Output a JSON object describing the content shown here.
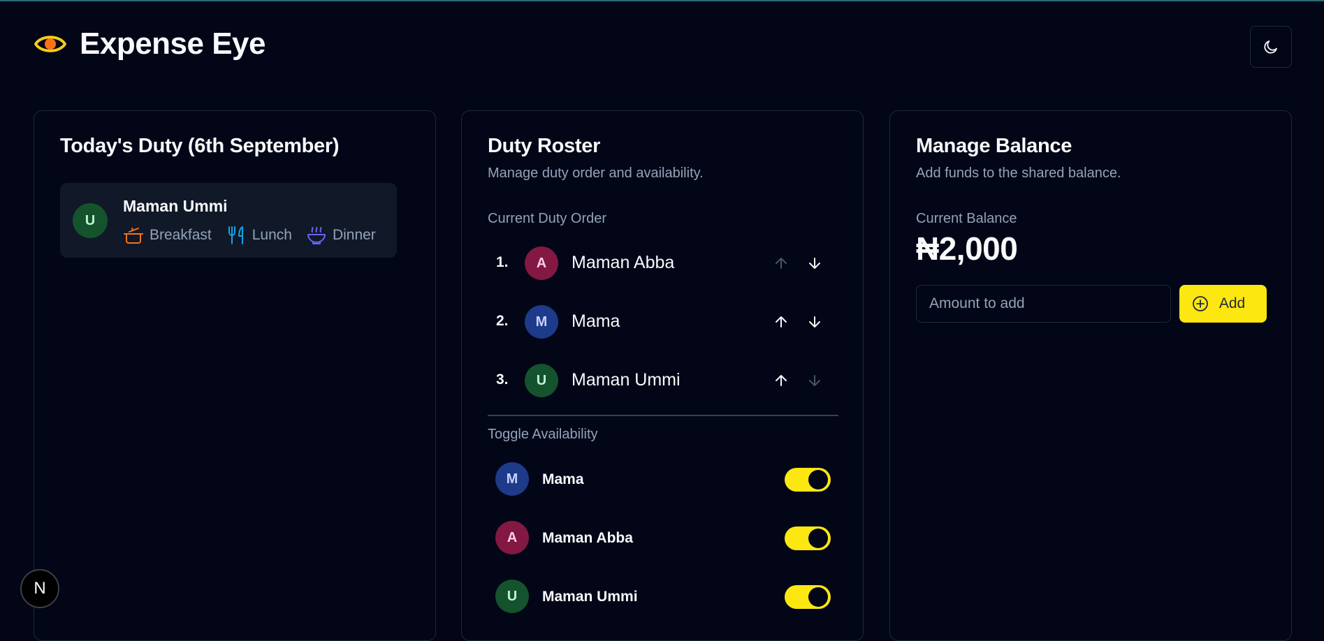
{
  "app": {
    "title": "Expense Eye"
  },
  "theme_toggle": {
    "icon": "moon-icon"
  },
  "today_duty": {
    "title": "Today's Duty (6th September)",
    "person": {
      "name": "Maman Ummi",
      "initial": "U"
    },
    "meals": [
      {
        "label": "Breakfast",
        "icon": "cooking-pot-icon",
        "color": "#f97316"
      },
      {
        "label": "Lunch",
        "icon": "utensils-icon",
        "color": "#0ea5e9"
      },
      {
        "label": "Dinner",
        "icon": "soup-bowl-icon",
        "color": "#6366f1"
      }
    ]
  },
  "roster": {
    "title": "Duty Roster",
    "description": "Manage duty order and availability.",
    "order_label": "Current Duty Order",
    "order": [
      {
        "number": "1.",
        "initial": "A",
        "name": "Maman Abba",
        "color": "#831843",
        "up_enabled": false,
        "down_enabled": true
      },
      {
        "number": "2.",
        "initial": "M",
        "name": "Mama",
        "color": "#1e3a8a",
        "up_enabled": true,
        "down_enabled": true
      },
      {
        "number": "3.",
        "initial": "U",
        "name": "Maman Ummi",
        "color": "#14532d",
        "up_enabled": true,
        "down_enabled": false
      }
    ],
    "availability_label": "Toggle Availability",
    "availability": [
      {
        "initial": "M",
        "name": "Mama",
        "available": true
      },
      {
        "initial": "A",
        "name": "Maman Abba",
        "available": true
      },
      {
        "initial": "U",
        "name": "Maman Ummi",
        "available": true
      }
    ]
  },
  "balance": {
    "title": "Manage Balance",
    "description": "Add funds to the shared balance.",
    "current_label": "Current Balance",
    "current_value": "₦2,000",
    "input_placeholder": "Amount to add",
    "add_label": "Add",
    "accent": "#fde711"
  },
  "dev_badge": {
    "letter": "N"
  }
}
